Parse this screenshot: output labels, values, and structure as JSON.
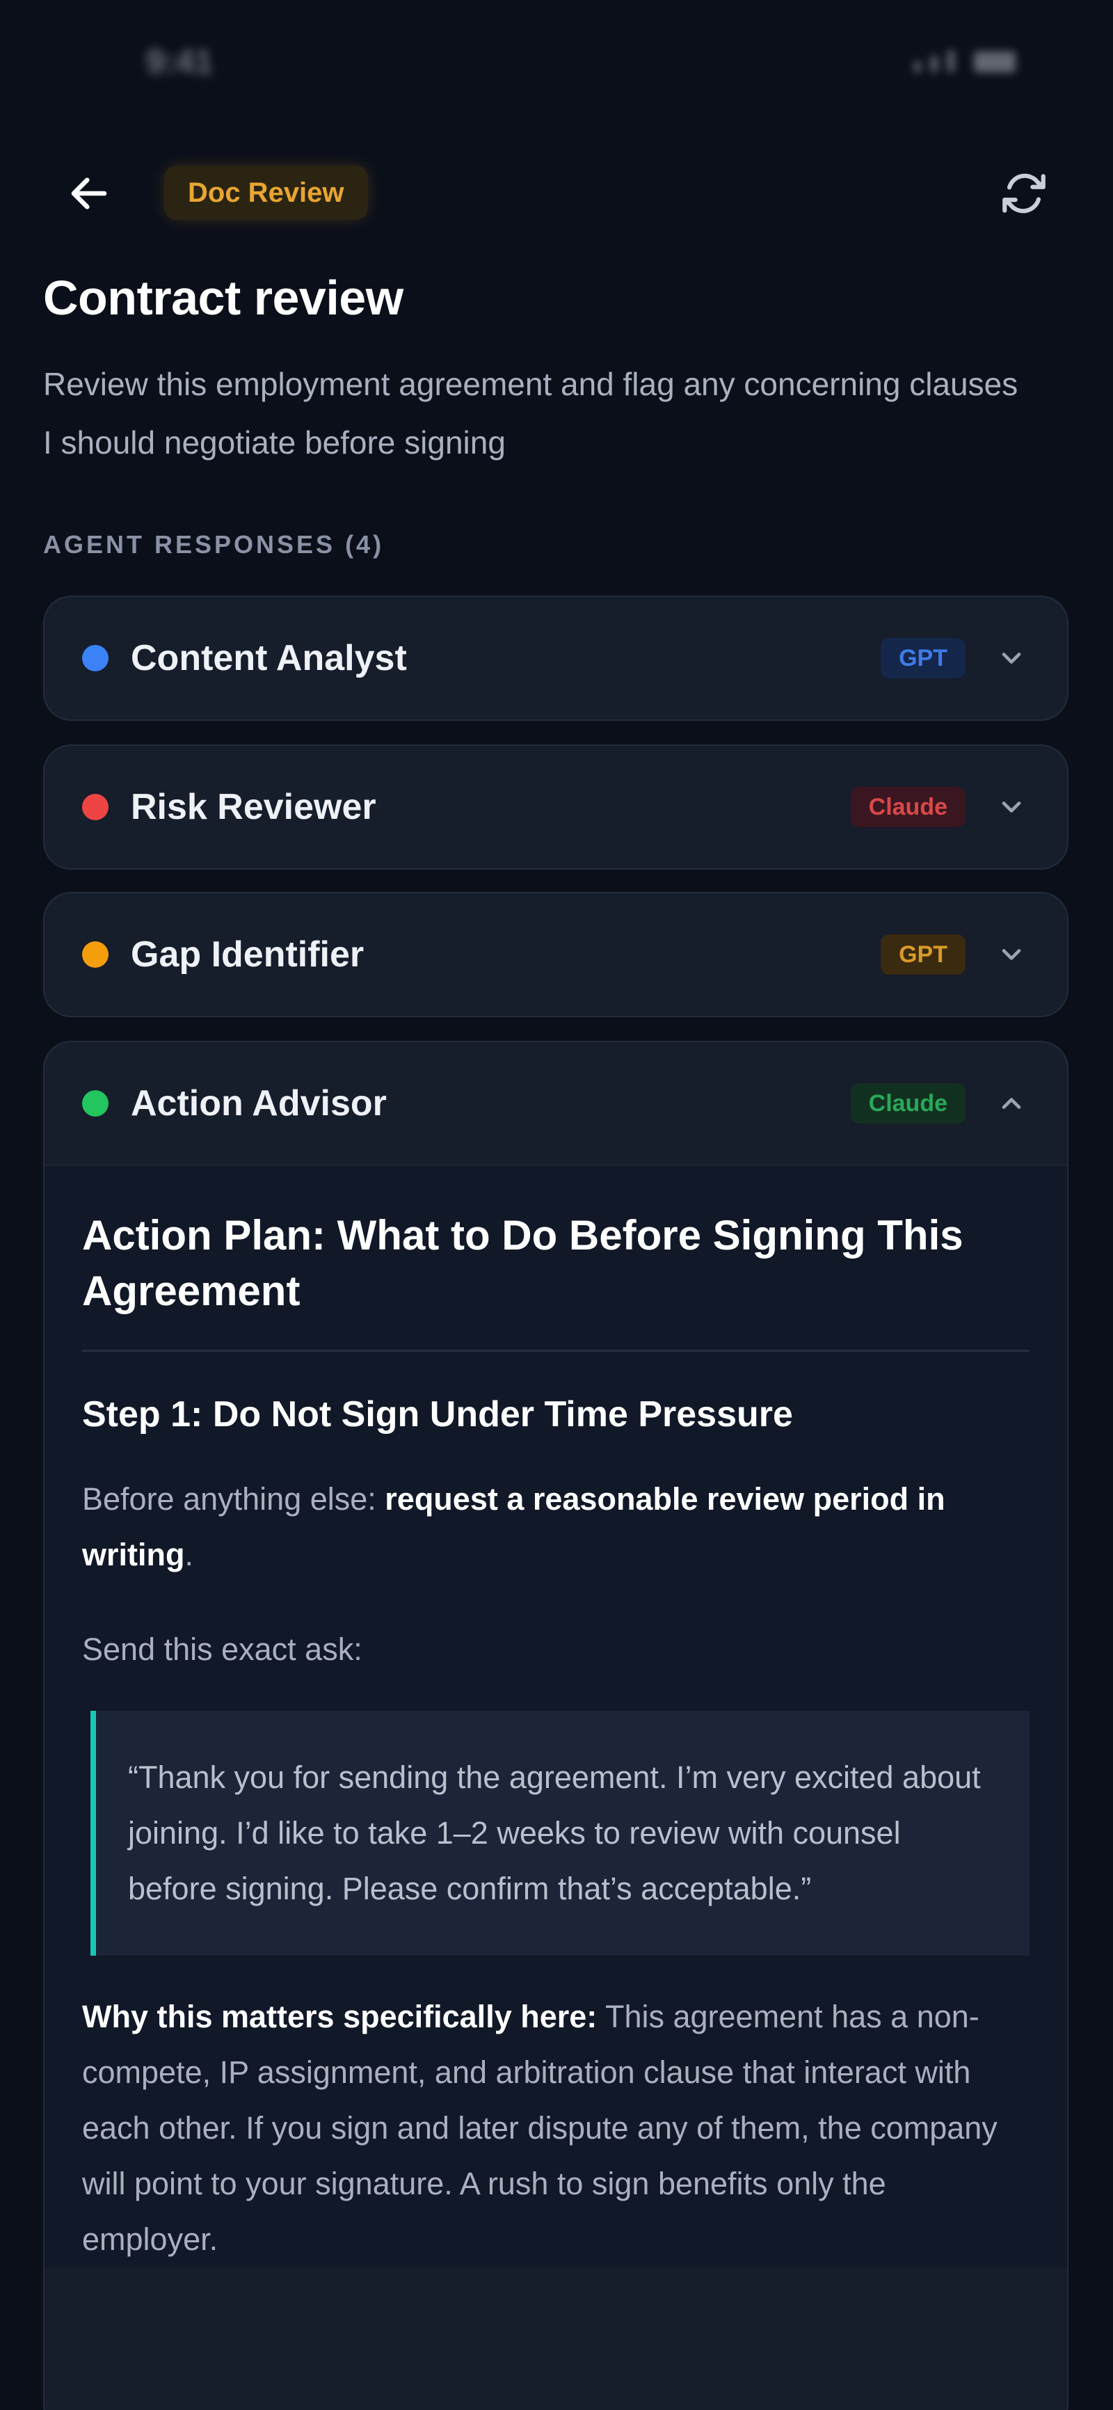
{
  "status_bar": {
    "time": "9:41"
  },
  "nav": {
    "badge_label": "Doc Review",
    "back_icon": "arrow-left-icon",
    "refresh_icon": "refresh-icon",
    "badge_color": "#e8a531"
  },
  "header": {
    "title": "Contract review",
    "subtitle": "Review this employment agreement and flag any concerning clauses I should negotiate before signing"
  },
  "section_label": "AGENT RESPONSES (4)",
  "agents": [
    {
      "name": "Content Analyst",
      "model": "GPT",
      "dot_color": "#3b82f6",
      "badge_bg": "#14264a",
      "badge_fg": "#3f7be8",
      "expanded": false
    },
    {
      "name": "Risk Reviewer",
      "model": "Claude",
      "dot_color": "#ef4444",
      "badge_bg": "#3a1620",
      "badge_fg": "#d94848",
      "expanded": false
    },
    {
      "name": "Gap Identifier",
      "model": "GPT",
      "dot_color": "#f59e0b",
      "badge_bg": "#3a2a10",
      "badge_fg": "#d99a28",
      "expanded": false
    },
    {
      "name": "Action Advisor",
      "model": "Claude",
      "dot_color": "#22c55e",
      "badge_bg": "#12301f",
      "badge_fg": "#28a85a",
      "expanded": true
    }
  ],
  "action_plan": {
    "title": "Action Plan: What to Do Before Signing This Agreement",
    "step1_title": "Step 1: Do Not Sign Under Time Pressure",
    "step1_intro_prefix": "Before anything else: ",
    "step1_intro_bold": "request a reasonable review period in writing",
    "step1_intro_suffix": ".",
    "send_ask": "Send this exact ask:",
    "quote": "“Thank you for sending the agreement. I’m very excited about joining. I’d like to take 1–2 weeks to review with counsel before signing. Please confirm that’s acceptable.”",
    "quote_accent": "#19c6b2",
    "why_bold": "Why this matters specifically here:",
    "why_text": " This agreement has a non-compete, IP assignment, and arbitration clause that interact with each other. If you sign and later dispute any of them, the company will point to your signature. A rush to sign benefits only the employer."
  }
}
